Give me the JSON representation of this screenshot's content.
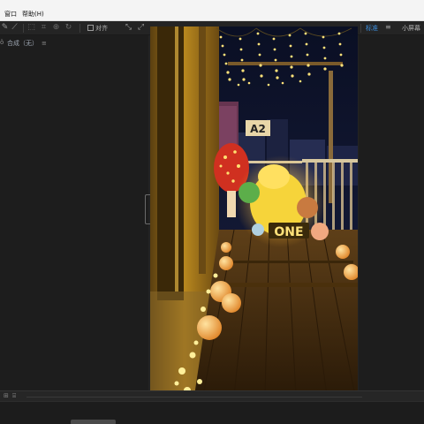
{
  "menubar": {
    "window_label": "窗口",
    "help_label": "帮助(H)"
  },
  "toolbar": {
    "snap_label": "对齐",
    "workspace_default": "标准",
    "workspace_small": "小屏幕"
  },
  "composition_panel": {
    "tab_label": "合成（无）"
  },
  "video": {
    "sign_text": "A2",
    "marquee_text": "ONE"
  },
  "icons": {
    "pen_tool": "pen-icon",
    "brush_tool": "brush-icon",
    "panel_menu": "hamburger-menu-icon",
    "snap_checkbox": "checkbox-icon"
  },
  "colors": {
    "workspace_accent": "#3c8fe0",
    "light_glow": "#ffd24a",
    "menubar_bg": "#f4f4f4"
  }
}
